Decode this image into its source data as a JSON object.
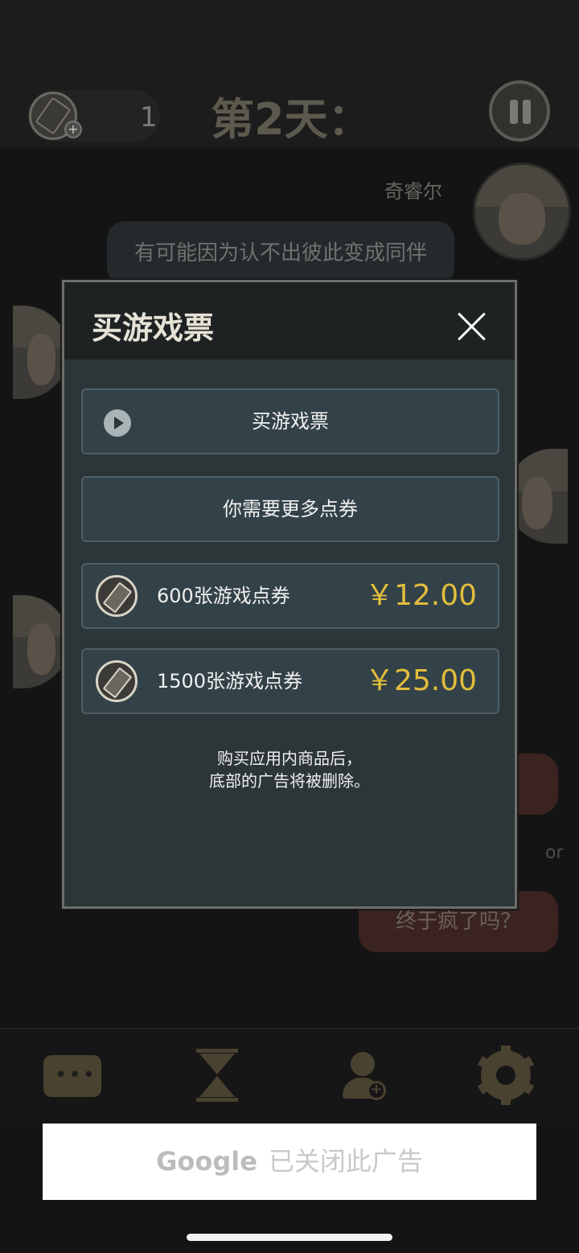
{
  "header": {
    "tickets_count": "1",
    "day_title": "第2天："
  },
  "chat": {
    "speaker_name": "奇睿尔",
    "message_1": "有可能因为认不出彼此变成同伴",
    "or_text": "or",
    "reply_option": "终于疯了吗？"
  },
  "bottom_nav": {
    "items": [
      "chat-icon",
      "hourglass-icon",
      "add-user-icon",
      "gear-icon"
    ]
  },
  "ad": {
    "google_label": "Google",
    "closed_text": "已关闭此广告"
  },
  "modal": {
    "title": "买游戏票",
    "watch_button_label": "买游戏票",
    "more_coupons_label": "你需要更多点券",
    "packages": [
      {
        "name": "600张游戏点券",
        "price": "￥12.00"
      },
      {
        "name": "1500张游戏点券",
        "price": "￥25.00"
      }
    ],
    "note_line_1": "购买应用内商品后，",
    "note_line_2": "底部的广告将被删除。"
  },
  "colors": {
    "price": "#e2bd3c",
    "modal_bg": "#2c3538",
    "button_bg": "#334248"
  }
}
